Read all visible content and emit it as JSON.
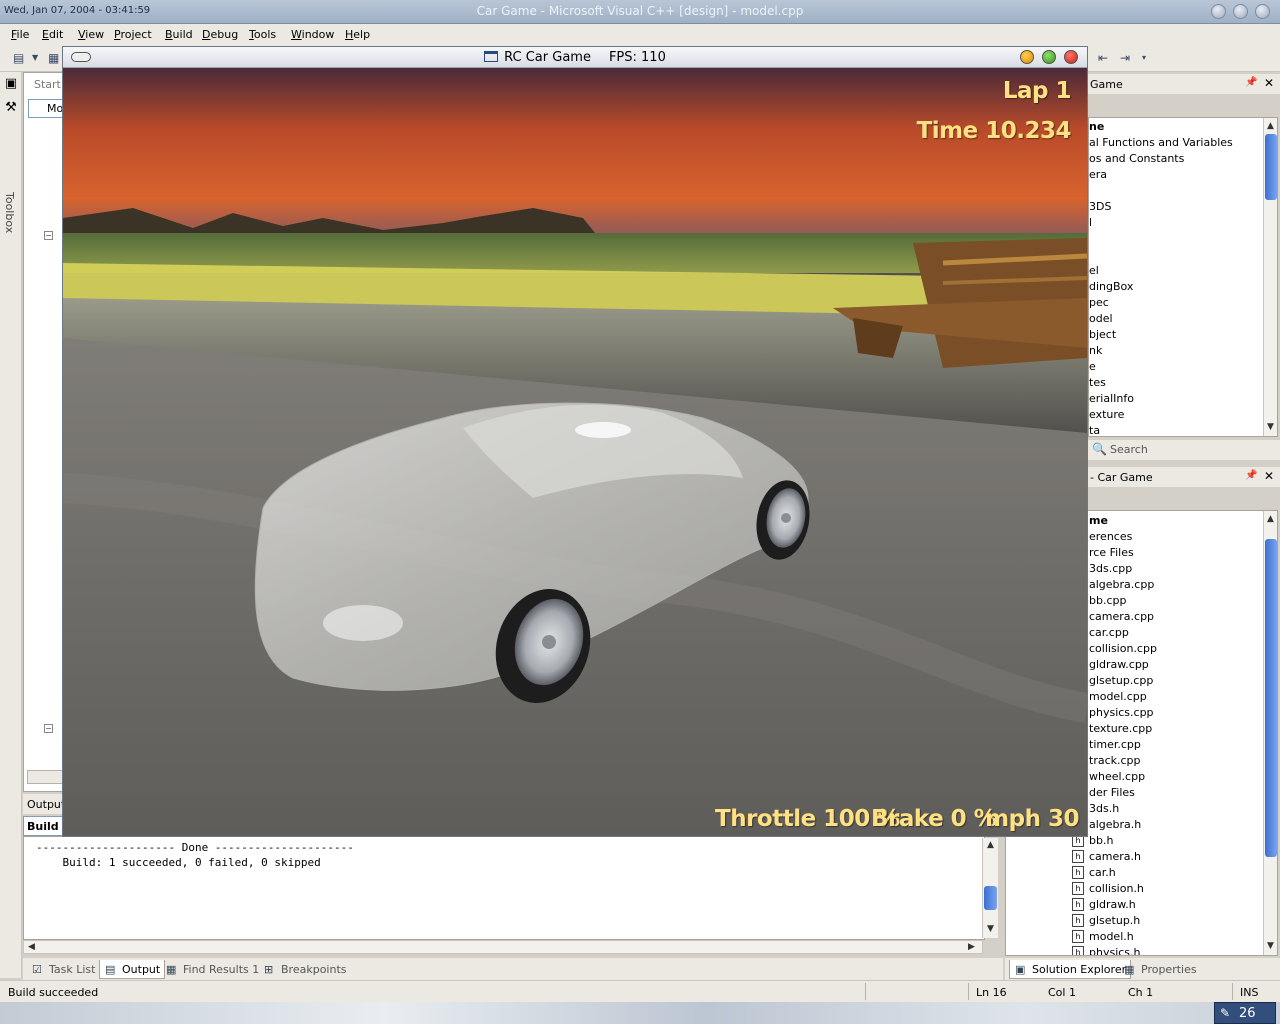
{
  "titlebar": {
    "datetime": "Wed, Jan 07, 2004 - 03:41:59",
    "title": "Car Game - Microsoft Visual C++ [design] - model.cpp"
  },
  "menu": [
    "File",
    "Edit",
    "View",
    "Project",
    "Build",
    "Debug",
    "Tools",
    "Window",
    "Help"
  ],
  "left_strip": {
    "toolbox_label": "Toolbox"
  },
  "editor": {
    "start_tab": "Start",
    "combo_value": "Mo"
  },
  "output_panel": {
    "title": "Output",
    "combo_value": "Build",
    "lines": [
      "--------------------- Done ---------------------",
      "",
      "    Build: 1 succeeded, 0 failed, 0 skipped"
    ],
    "scroll_fraction": 0.7
  },
  "bottom_tabs": [
    "Task List",
    "Output",
    "Find Results 1",
    "Breakpoints"
  ],
  "class_view": {
    "header": "Game",
    "items": [
      {
        "text": "ne",
        "bold": true
      },
      {
        "text": "al Functions and Variables"
      },
      {
        "text": "os and Constants"
      },
      {
        "text": "era"
      },
      {
        "text": ""
      },
      {
        "text": "3DS"
      },
      {
        "text": "l"
      },
      {
        "text": ""
      },
      {
        "text": ""
      },
      {
        "text": "el"
      },
      {
        "text": "dingBox"
      },
      {
        "text": "pec"
      },
      {
        "text": "odel"
      },
      {
        "text": "bject"
      },
      {
        "text": "nk"
      },
      {
        "text": "e"
      },
      {
        "text": "tes"
      },
      {
        "text": "erialInfo"
      },
      {
        "text": "exture"
      },
      {
        "text": "ta"
      }
    ]
  },
  "search": {
    "label": "Search"
  },
  "solution_explorer": {
    "header": "- Car Game",
    "items": [
      {
        "text": "me",
        "bold": true
      },
      {
        "text": "erences"
      },
      {
        "text": "rce Files"
      },
      {
        "text": "3ds.cpp"
      },
      {
        "text": "algebra.cpp"
      },
      {
        "text": "bb.cpp"
      },
      {
        "text": "camera.cpp"
      },
      {
        "text": "car.cpp"
      },
      {
        "text": "collision.cpp"
      },
      {
        "text": "gldraw.cpp"
      },
      {
        "text": "glsetup.cpp"
      },
      {
        "text": "model.cpp"
      },
      {
        "text": "physics.cpp"
      },
      {
        "text": "texture.cpp"
      },
      {
        "text": "timer.cpp"
      },
      {
        "text": "track.cpp"
      },
      {
        "text": "wheel.cpp"
      },
      {
        "text": "der Files"
      },
      {
        "text": "3ds.h"
      },
      {
        "text": "algebra.h"
      },
      {
        "text": "bb.h"
      },
      {
        "text": "camera.h"
      },
      {
        "text": "car.h"
      },
      {
        "text": "collision.h"
      },
      {
        "text": "gldraw.h"
      },
      {
        "text": "glsetup.h"
      },
      {
        "text": "model.h"
      },
      {
        "text": "physics.h"
      }
    ]
  },
  "right_bottom_tabs": [
    "Solution Explorer",
    "Properties"
  ],
  "statusbar": {
    "message": "Build succeeded",
    "ln": "Ln 16",
    "col": "Col 1",
    "ch": "Ch 1",
    "mode": "INS"
  },
  "tray": {
    "badge": "26"
  },
  "game": {
    "title": "RC Car Game",
    "fps": "FPS: 110",
    "lap": "Lap 1",
    "time": "Time 10.234",
    "throttle": "Throttle 100 %",
    "brake": "Brake  0 %",
    "speed": "mph 30"
  },
  "colors": {
    "hud": "#ffe083",
    "accent": "#3b6fd2"
  }
}
